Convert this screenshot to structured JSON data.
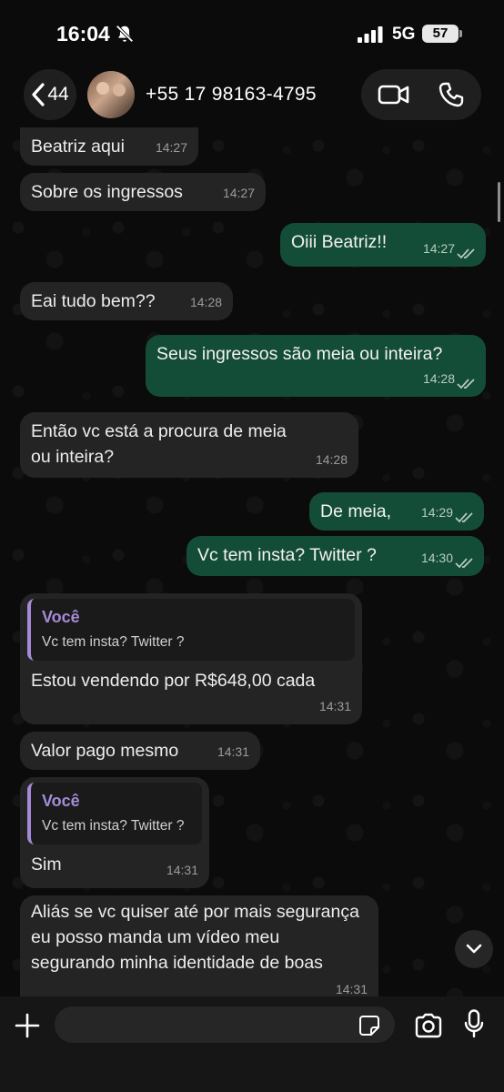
{
  "status_bar": {
    "time": "16:04",
    "network": "5G",
    "battery": "57"
  },
  "header": {
    "back_count": "44",
    "contact_name": "+55 17 98163-4795"
  },
  "messages": [
    {
      "direction": "in",
      "text": "Beatriz aqui",
      "time": "14:27"
    },
    {
      "direction": "in",
      "text": "Sobre os ingressos",
      "time": "14:27"
    },
    {
      "direction": "out",
      "text": "Oiii Beatriz!!",
      "time": "14:27",
      "read": true
    },
    {
      "direction": "in",
      "text": "Eai tudo bem??",
      "time": "14:28"
    },
    {
      "direction": "out",
      "text": "Seus ingressos são meia ou inteira?",
      "time": "14:28",
      "read": true
    },
    {
      "direction": "in",
      "text": "Então vc está a procura de meia ou inteira?",
      "time": "14:28"
    },
    {
      "direction": "out",
      "text": "De meia,",
      "time": "14:29",
      "read": true
    },
    {
      "direction": "out",
      "text": "Vc tem insta? Twitter ?",
      "time": "14:30",
      "read": true
    },
    {
      "direction": "in",
      "quote_author": "Você",
      "quote_text": "Vc tem insta? Twitter ?",
      "text": "Estou vendendo por R$648,00 cada",
      "time": "14:31"
    },
    {
      "direction": "in",
      "text": "Valor pago mesmo",
      "time": "14:31"
    },
    {
      "direction": "in",
      "quote_author": "Você",
      "quote_text": "Vc tem insta? Twitter ?",
      "text": "Sim",
      "time": "14:31"
    },
    {
      "direction": "in",
      "text": "Aliás se vc quiser até por mais segurança eu posso manda um vídeo meu segurando minha identidade de boas",
      "time": "14:31"
    }
  ],
  "composer": {
    "value": "",
    "placeholder": ""
  },
  "colors": {
    "incoming_bubble": "#242424",
    "outgoing_bubble": "#144d37",
    "quote_accent": "#a48bd9",
    "background": "#0b0b0b"
  },
  "icons": [
    "bell-slash-icon",
    "signal-icon",
    "chevron-left-icon",
    "video-camera-icon",
    "phone-icon",
    "double-check-icon",
    "chevron-down-icon",
    "plus-icon",
    "sticker-icon",
    "camera-icon",
    "microphone-icon"
  ]
}
